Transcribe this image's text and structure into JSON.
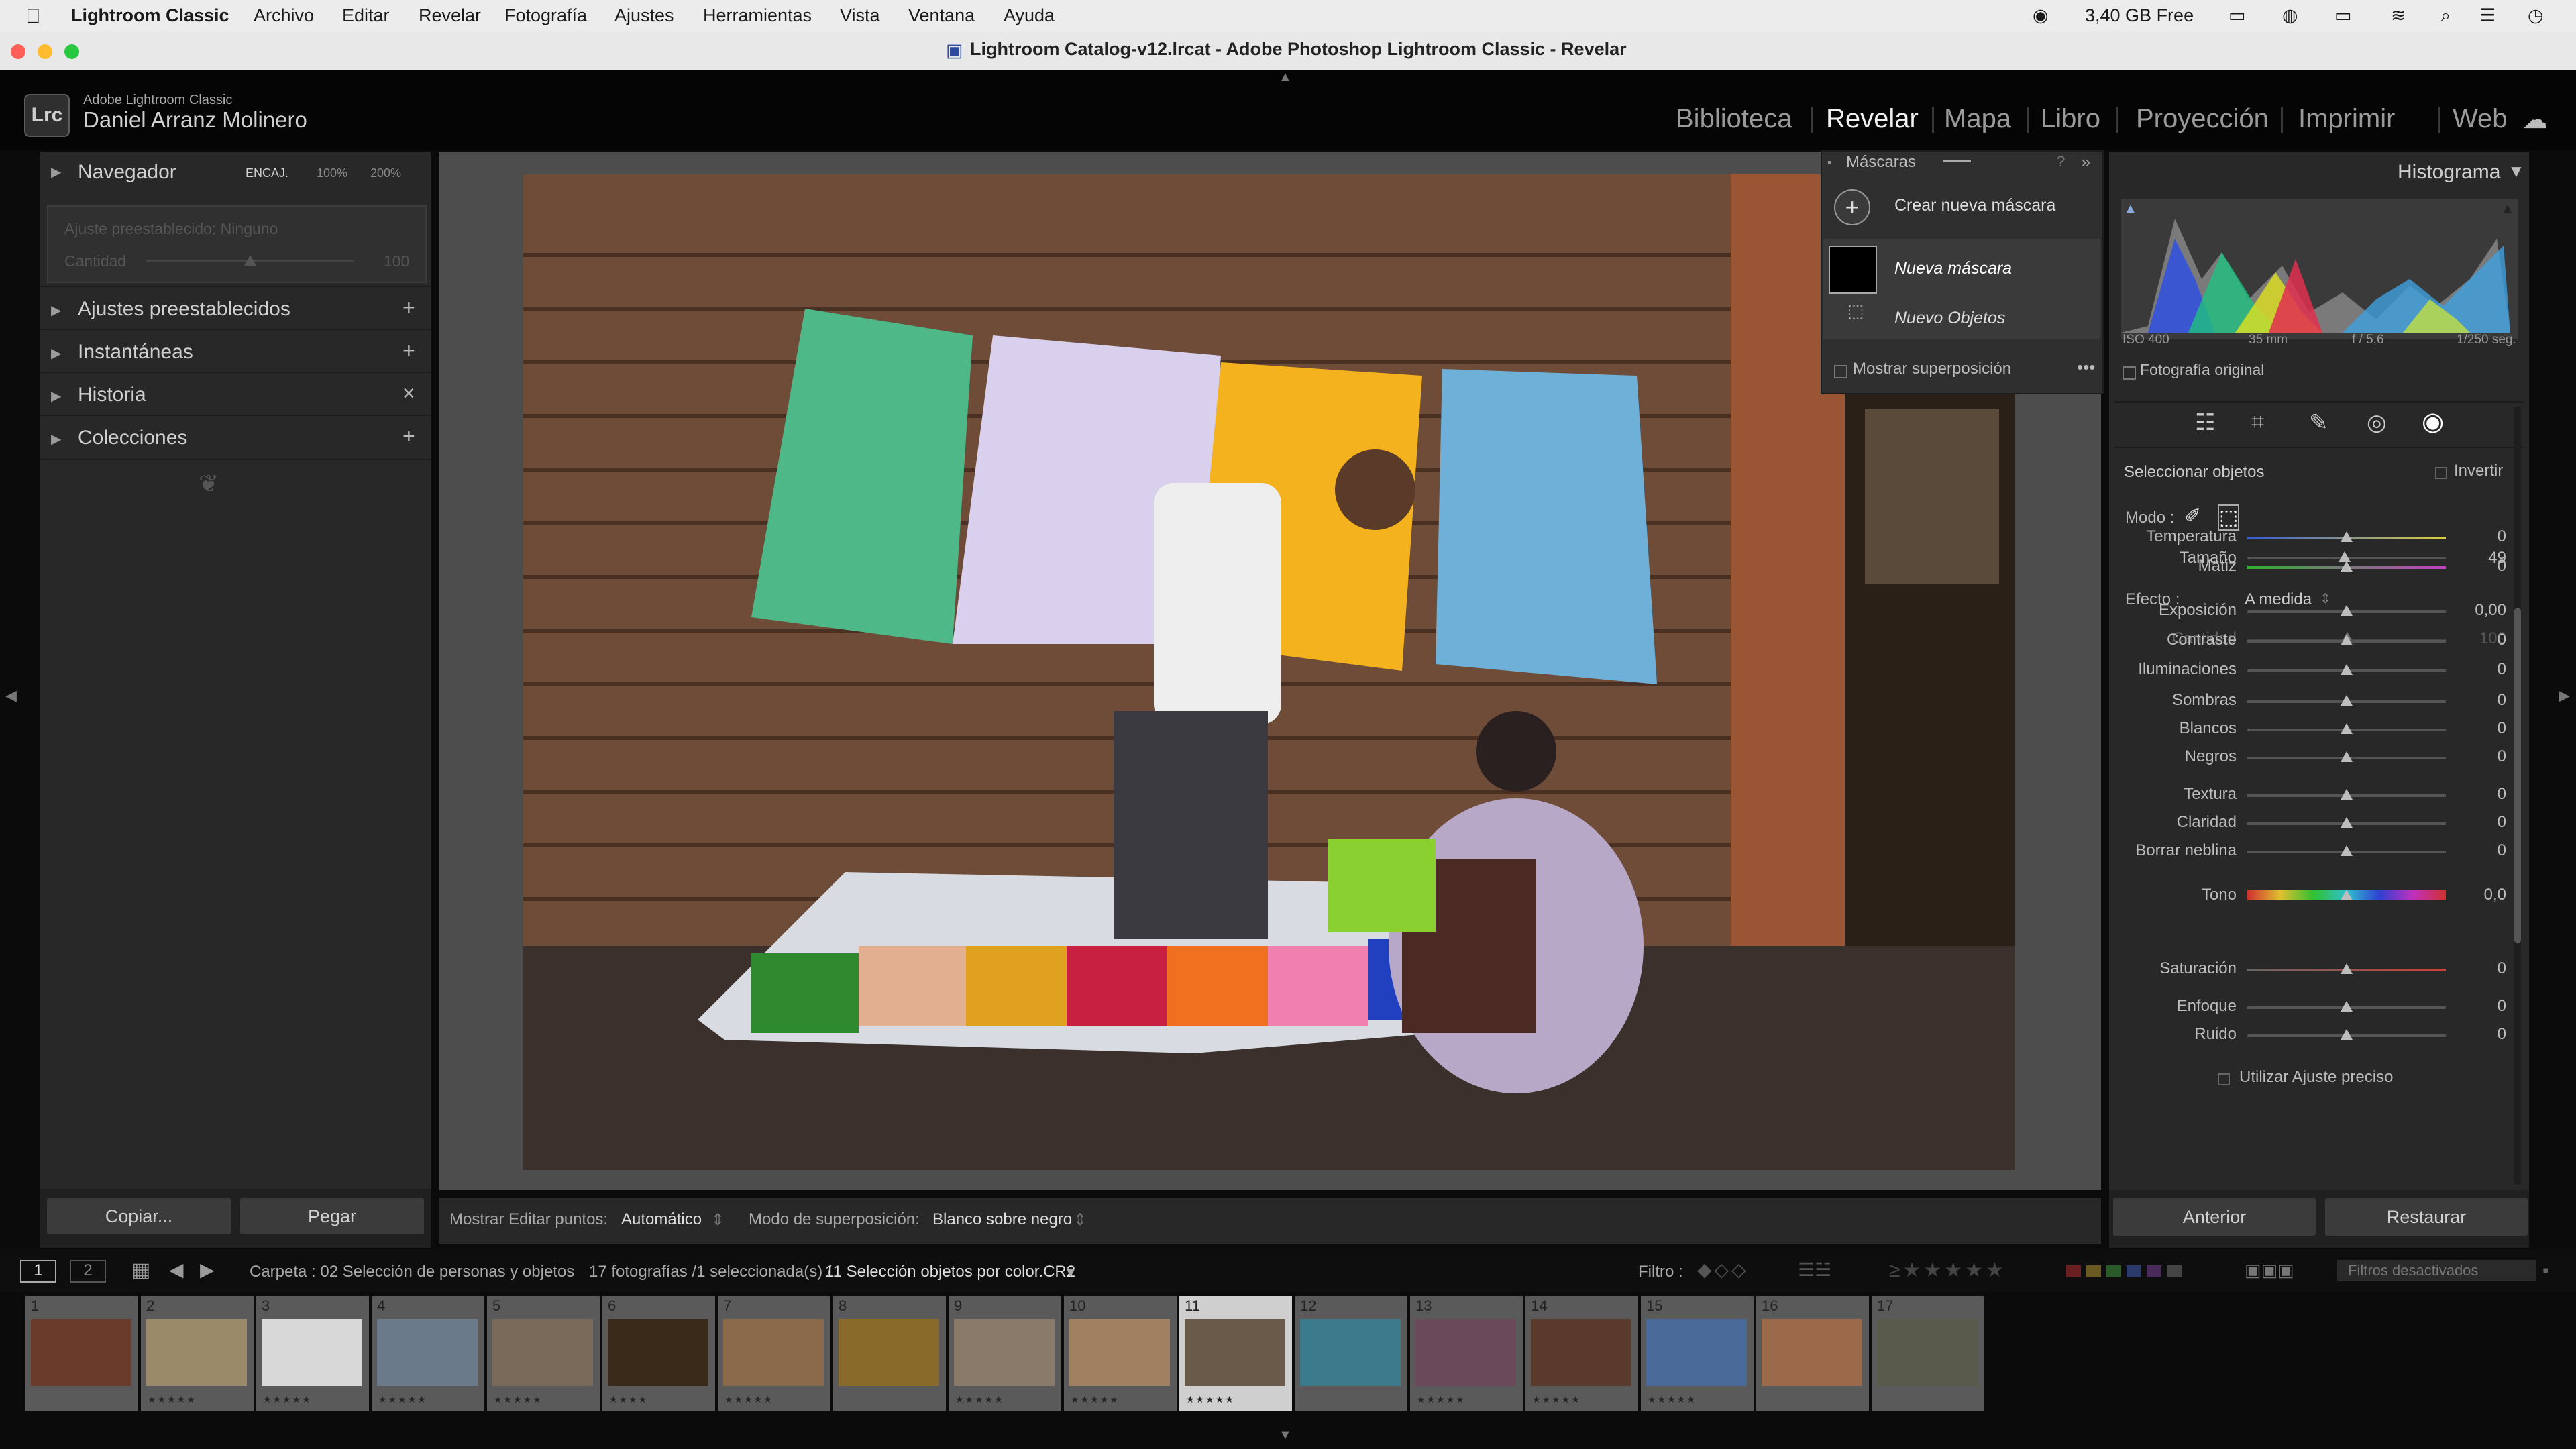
{
  "menubar": {
    "app": "Lightroom Classic",
    "items": [
      "Archivo",
      "Editar",
      "Revelar",
      "Fotografía",
      "Ajustes",
      "Herramientas",
      "Vista",
      "Ventana",
      "Ayuda"
    ],
    "free_space": "3,40 GB Free"
  },
  "window_title": "Lightroom Catalog-v12.lrcat - Adobe Photoshop Lightroom Classic - Revelar",
  "identity": {
    "product": "Adobe Lightroom Classic",
    "user": "Daniel Arranz Molinero",
    "logo": "Lrc"
  },
  "modules": [
    "Biblioteca",
    "Revelar",
    "Mapa",
    "Libro",
    "Proyección",
    "Imprimir",
    "Web"
  ],
  "left_panel": {
    "navigator": {
      "title": "Navegador",
      "zoom": [
        "ENCAJ.",
        "100%",
        "200%"
      ]
    },
    "preset_box": {
      "label": "Ajuste preestablecido: Ninguno",
      "amount_label": "Cantidad",
      "amount_value": "100"
    },
    "sections": [
      {
        "title": "Ajustes preestablecidos",
        "action": "+"
      },
      {
        "title": "Instantáneas",
        "action": "+"
      },
      {
        "title": "Historia",
        "action": "×"
      },
      {
        "title": "Colecciones",
        "action": "+"
      }
    ],
    "copy_button": "Copiar...",
    "paste_button": "Pegar"
  },
  "toolbar": {
    "show_edit_points_label": "Mostrar Editar puntos:",
    "show_edit_points_value": "Automático",
    "overlay_mode_label": "Modo de superposición:",
    "overlay_mode_value": "Blanco sobre negro"
  },
  "masks_panel": {
    "title": "Máscaras",
    "create_new": "Crear nueva máscara",
    "new_mask": "Nueva máscara",
    "new_objects": "Nuevo Objetos",
    "show_overlay": "Mostrar superposición"
  },
  "histogram": {
    "title": "Histograma",
    "iso": "ISO 400",
    "focal": "35 mm",
    "aperture": "f / 5,6",
    "shutter": "1/250 seg.",
    "original_photo": "Fotografía original"
  },
  "mask_settings": {
    "select_objects": "Seleccionar objetos",
    "invert": "Invertir",
    "mode_label": "Modo :",
    "size_label": "Tamaño",
    "size_value": "49",
    "effect_label": "Efecto :",
    "effect_value": "A medida",
    "amount_label": "Cantidad",
    "amount_value": "100",
    "precise_adjust": "Utilizar Ajuste preciso",
    "sliders": [
      {
        "label": "Temperatura",
        "value": "0",
        "pos": 0.5
      },
      {
        "label": "Matiz",
        "value": "0",
        "pos": 0.5
      },
      {
        "label": "Exposición",
        "value": "0,00",
        "pos": 0.5
      },
      {
        "label": "Contraste",
        "value": "0",
        "pos": 0.5
      },
      {
        "label": "Iluminaciones",
        "value": "0",
        "pos": 0.5
      },
      {
        "label": "Sombras",
        "value": "0",
        "pos": 0.5
      },
      {
        "label": "Blancos",
        "value": "0",
        "pos": 0.5
      },
      {
        "label": "Negros",
        "value": "0",
        "pos": 0.5
      },
      {
        "label": "Textura",
        "value": "0",
        "pos": 0.5
      },
      {
        "label": "Claridad",
        "value": "0",
        "pos": 0.5
      },
      {
        "label": "Borrar neblina",
        "value": "0",
        "pos": 0.5
      },
      {
        "label": "Tono",
        "value": "0,0",
        "pos": 0.5
      },
      {
        "label": "Saturación",
        "value": "0",
        "pos": 0.5
      },
      {
        "label": "Enfoque",
        "value": "0",
        "pos": 0.5
      },
      {
        "label": "Ruido",
        "value": "0",
        "pos": 0.5
      }
    ]
  },
  "right_buttons": {
    "previous": "Anterior",
    "reset": "Restaurar"
  },
  "filmstrip_bar": {
    "pages": [
      "1",
      "2"
    ],
    "folder": "Carpeta : 02 Selección de personas y objetos",
    "count": "17 fotografías /1 seleccionada(s) /",
    "current": "11 Selección objetos por color.CR2",
    "filter_label": "Filtro :",
    "filters_off": "Filtros desactivados"
  },
  "thumbnails": [
    {
      "n": "1",
      "stars": "",
      "color": "#6a3a2a"
    },
    {
      "n": "2",
      "stars": "★★★★★",
      "color": "#9a8a6a"
    },
    {
      "n": "3",
      "stars": "★★★★★",
      "color": "#d8d8d8"
    },
    {
      "n": "4",
      "stars": "★★★★★",
      "color": "#6a7a8a"
    },
    {
      "n": "5",
      "stars": "★★★★★",
      "color": "#7a6a5a"
    },
    {
      "n": "6",
      "stars": "★★★★",
      "color": "#3a2a1a"
    },
    {
      "n": "7",
      "stars": "★★★★★",
      "color": "#8a6a4a"
    },
    {
      "n": "8",
      "stars": "",
      "color": "#8a6a2a"
    },
    {
      "n": "9",
      "stars": "★★★★★",
      "color": "#8a7a6a"
    },
    {
      "n": "10",
      "stars": "★★★★★",
      "color": "#a08060"
    },
    {
      "n": "11",
      "stars": "★★★★★",
      "color": "#6a5a4a"
    },
    {
      "n": "12",
      "stars": "",
      "color": "#3a7a8a"
    },
    {
      "n": "13",
      "stars": "★★★★★",
      "color": "#6a4a5a"
    },
    {
      "n": "14",
      "stars": "★★★★★",
      "color": "#5a3a2a"
    },
    {
      "n": "15",
      "stars": "★★★★★",
      "color": "#4a6a9a"
    },
    {
      "n": "16",
      "stars": "",
      "color": "#9a6a4a"
    },
    {
      "n": "17",
      "stars": "",
      "color": "#5a5a4a"
    }
  ]
}
